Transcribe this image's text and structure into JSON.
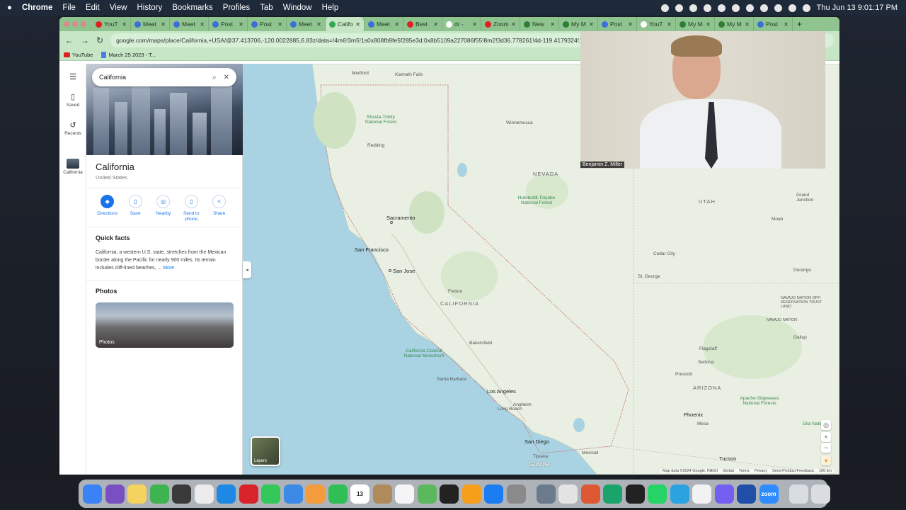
{
  "menubar": {
    "app_name": "Chrome",
    "items": [
      "File",
      "Edit",
      "View",
      "History",
      "Bookmarks",
      "Profiles",
      "Tab",
      "Window",
      "Help"
    ],
    "clock": "Thu Jun 13  9:01:17 PM"
  },
  "tabs": [
    {
      "label": "YouT",
      "icon": "youtube-icon"
    },
    {
      "label": "Meet",
      "icon": "meet-icon"
    },
    {
      "label": "Meet",
      "icon": "meet-icon"
    },
    {
      "label": "Post",
      "icon": "post-icon"
    },
    {
      "label": "Post",
      "icon": "post-icon"
    },
    {
      "label": "Meet",
      "icon": "meet-icon"
    },
    {
      "label": "Califo",
      "icon": "maps-pin-icon",
      "active": true
    },
    {
      "label": "Meet",
      "icon": "meet-icon"
    },
    {
      "label": "Best",
      "icon": "youtube-icon"
    },
    {
      "label": "dr -",
      "icon": "google-icon"
    },
    {
      "label": "Zoom",
      "icon": "youtube-icon"
    },
    {
      "label": "New",
      "icon": "web-icon"
    },
    {
      "label": "My M",
      "icon": "web-icon"
    },
    {
      "label": "Post",
      "icon": "post-icon"
    },
    {
      "label": "YouT",
      "icon": "google-icon"
    },
    {
      "label": "My M",
      "icon": "web-icon"
    },
    {
      "label": "My M",
      "icon": "web-icon"
    },
    {
      "label": "Post",
      "icon": "post-icon"
    }
  ],
  "address_bar": {
    "url": "google.com/maps/place/California,+USA/@37.413706,-120.0022885,6.83z/data=!4m6!3m5!1s0x808fb9fe5f285e3d:0x8b5109a227086f55!8m2!3d36.778261!4d-119.4179324!16zL2"
  },
  "bookmarks": [
    {
      "label": "YouTube",
      "icon": "youtube-icon"
    },
    {
      "label": "March 25 2023 - T...",
      "icon": "doc-icon"
    }
  ],
  "rail": {
    "saved": "Saved",
    "recents": "Recents",
    "place": "California"
  },
  "place_panel": {
    "search_value": "California",
    "title": "California",
    "subtitle": "United States",
    "actions": [
      {
        "label": "Directions",
        "icon": "directions-icon",
        "glyph": "◆"
      },
      {
        "label": "Save",
        "icon": "bookmark-icon",
        "glyph": "▯"
      },
      {
        "label": "Nearby",
        "icon": "nearby-icon",
        "glyph": "◎"
      },
      {
        "label": "Send to phone",
        "icon": "phone-icon",
        "glyph": "▯"
      },
      {
        "label": "Share",
        "icon": "share-icon",
        "glyph": "<"
      }
    ],
    "quick_facts_heading": "Quick facts",
    "quick_facts_text": "California, a western U.S. state, stretches from the Mexican border along the Pacific for nearly 900 miles. Its terrain includes cliff-lined beaches, ...",
    "more_link": "More",
    "photos_heading": "Photos",
    "photos_label": "Photos"
  },
  "map": {
    "labels": {
      "medford": "Medford",
      "klamath": "Klamath Falls",
      "shasta": "Shasta-Trinity National Forest",
      "redding": "Redding",
      "winnemucca": "Winnemucca",
      "nevada": "NEVADA",
      "humboldt": "Humboldt-Toiyabe National Forest",
      "utah": "UTAH",
      "grand_junction": "Grand Junction",
      "moab": "Moab",
      "sacramento": "Sacramento",
      "san_francisco": "San Francisco",
      "san_jose": "San Jose",
      "cedar_city": "Cedar City",
      "durango": "Durango",
      "st_george": "St. George",
      "fresno": "Fresno",
      "california": "CALIFORNIA",
      "navajo_trust": "NAVAJO NATION OFF-RESERVATION TRUST LAND",
      "navajo_nation": "NAVAJO NATION",
      "bakersfield": "Bakersfield",
      "gallup": "Gallup",
      "ca_coastal": "California Coastal National Monument",
      "flagstaff": "Flagstaff",
      "sedona": "Sedona",
      "santa_barbara": "Santa Barbara",
      "prescott": "Prescott",
      "los_angeles": "Los Angeles",
      "long_beach": "Long Beach",
      "anaheim": "Anaheim",
      "arizona": "ARIZONA",
      "apache": "Apache-Sitgreaves National Forests",
      "phoenix": "Phoenix",
      "mesa": "Mesa",
      "gila": "Gila National",
      "san_diego": "San Diego",
      "mexicali": "Mexicali",
      "tijuana": "Tijuana",
      "tucson": "Tucson"
    },
    "layers_label": "Layers",
    "attribution": [
      "Map data ©2024 Google, INEGI",
      "Global",
      "Terms",
      "Privacy",
      "Send Product Feedback",
      "100 km"
    ],
    "google_logo": "Google"
  },
  "video": {
    "participant_name": "Benjamin Z. Miller"
  },
  "dock": {
    "apps": [
      {
        "icon": "finder-icon",
        "color": "#3b82f6"
      },
      {
        "icon": "podcast-icon",
        "color": "#7a4fc2"
      },
      {
        "icon": "notes-icon",
        "color": "#f4d35e"
      },
      {
        "icon": "numbers-icon",
        "color": "#3fb34f"
      },
      {
        "icon": "quicktime-icon",
        "color": "#3a3a3a"
      },
      {
        "icon": "launchpad-icon",
        "color": "#ececec"
      },
      {
        "icon": "safari-icon",
        "color": "#1e88e5"
      },
      {
        "icon": "opera-icon",
        "color": "#d8232a"
      },
      {
        "icon": "messages-icon",
        "color": "#34c759"
      },
      {
        "icon": "mail-icon",
        "color": "#3a8ae6"
      },
      {
        "icon": "photos-icon",
        "color": "#f49b3b"
      },
      {
        "icon": "facetime-icon",
        "color": "#2fbf55"
      },
      {
        "icon": "calendar-icon",
        "color": "#ffffff",
        "text_color": "#222",
        "text": "13"
      },
      {
        "icon": "package-icon",
        "color": "#b08a5a"
      },
      {
        "icon": "reminders-icon",
        "color": "#f5f5f5"
      },
      {
        "icon": "maps-icon",
        "color": "#5cb85c"
      },
      {
        "icon": "terminal-icon",
        "color": "#222222"
      },
      {
        "icon": "pages-icon",
        "color": "#f59f1b"
      },
      {
        "icon": "appstore-icon",
        "color": "#1c7cf2"
      },
      {
        "icon": "settings-icon",
        "color": "#8a8a8a"
      },
      {
        "sep": true
      },
      {
        "icon": "preview-icon",
        "color": "#6c7b8b"
      },
      {
        "icon": "chrome-icon",
        "color": "#e3e3e3"
      },
      {
        "icon": "duckduckgo-icon",
        "color": "#de5833"
      },
      {
        "icon": "edge-icon",
        "color": "#1aa36b"
      },
      {
        "icon": "voice-memos-icon",
        "color": "#222222"
      },
      {
        "icon": "whatsapp-icon",
        "color": "#25d366"
      },
      {
        "icon": "telegram-icon",
        "color": "#2aa3e0"
      },
      {
        "icon": "textedit-icon",
        "color": "#f2f2f2"
      },
      {
        "icon": "viber-icon",
        "color": "#7360f2"
      },
      {
        "icon": "thunderbolt-icon",
        "color": "#1f4fa8"
      },
      {
        "icon": "zoom-icon",
        "color": "#2d8cff",
        "text": "zoom"
      },
      {
        "sep": true
      },
      {
        "icon": "folder-icon",
        "color": "#d9dde2"
      },
      {
        "icon": "trash-icon",
        "color": "#d9dde2"
      }
    ]
  }
}
